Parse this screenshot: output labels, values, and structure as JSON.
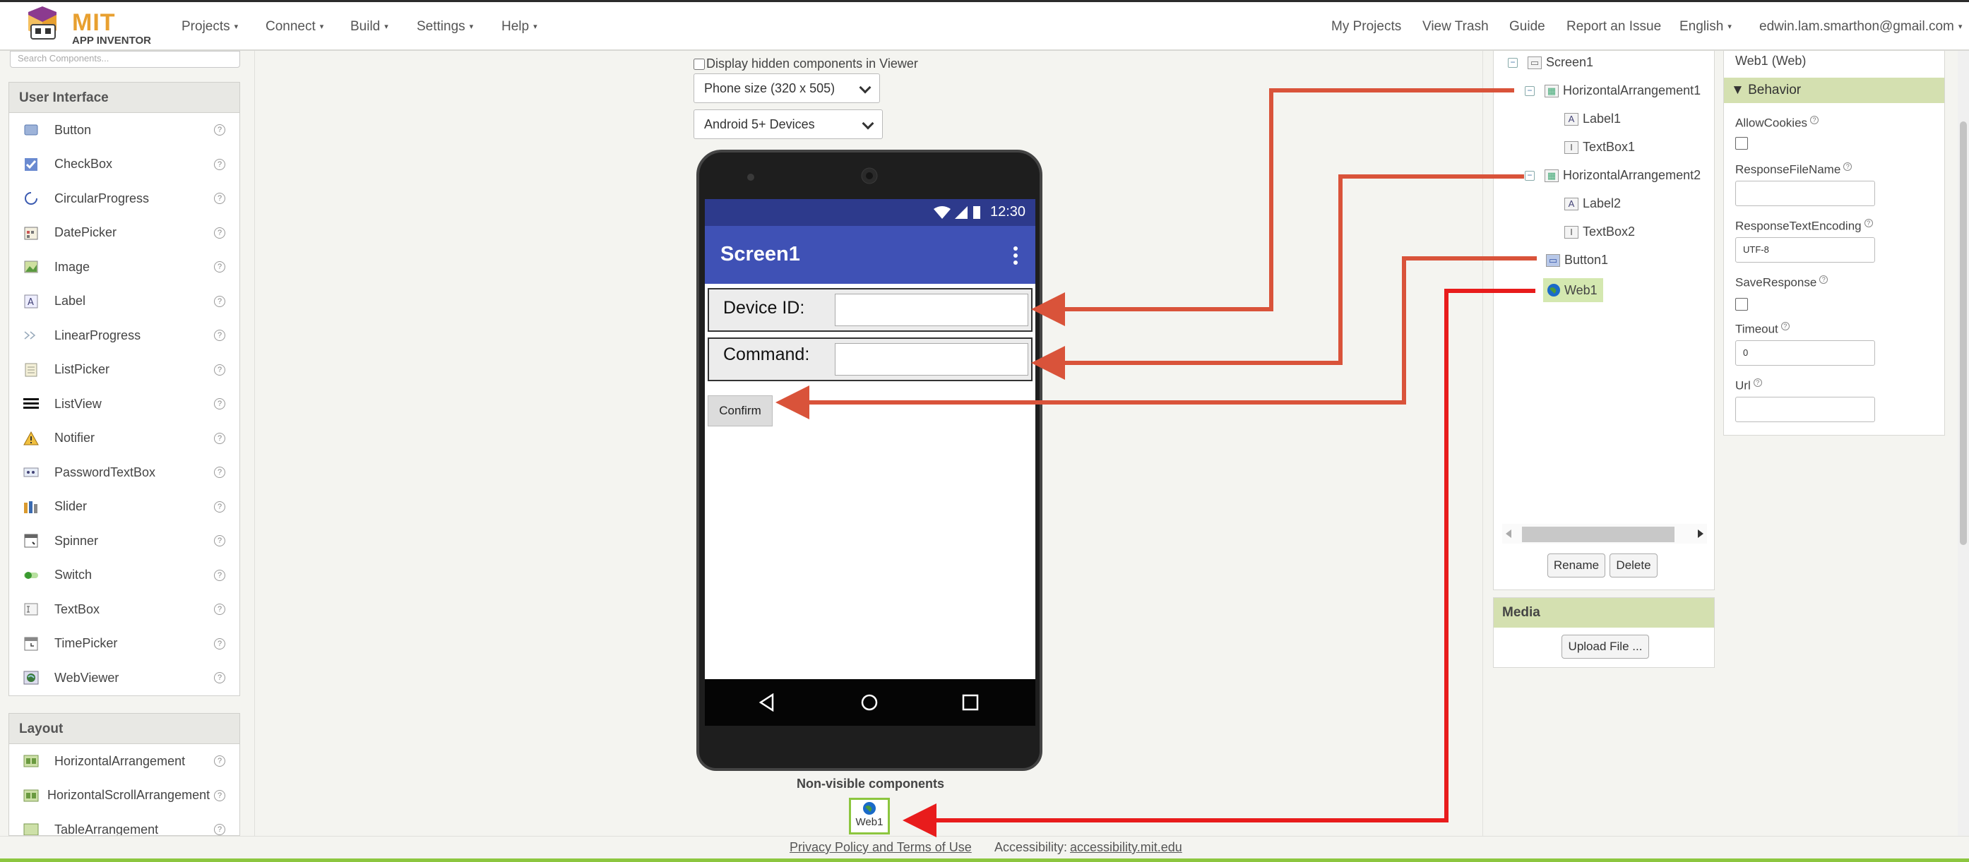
{
  "app": {
    "logo_main": "MIT",
    "logo_sub": "APP INVENTOR"
  },
  "topnav": {
    "left": [
      "Projects",
      "Connect",
      "Build",
      "Settings",
      "Help"
    ],
    "right": {
      "my_projects": "My Projects",
      "view_trash": "View Trash",
      "guide": "Guide",
      "report": "Report an Issue",
      "language": "English",
      "account": "edwin.lam.smarthon@gmail.com"
    }
  },
  "palette": {
    "search_placeholder": "Search Components...",
    "user_interface_header": "User Interface",
    "user_interface_items": [
      {
        "label": "Button",
        "icon": "button-icon"
      },
      {
        "label": "CheckBox",
        "icon": "checkbox-icon"
      },
      {
        "label": "CircularProgress",
        "icon": "circular-progress-icon"
      },
      {
        "label": "DatePicker",
        "icon": "datepicker-icon"
      },
      {
        "label": "Image",
        "icon": "image-icon"
      },
      {
        "label": "Label",
        "icon": "label-icon"
      },
      {
        "label": "LinearProgress",
        "icon": "linear-progress-icon"
      },
      {
        "label": "ListPicker",
        "icon": "listpicker-icon"
      },
      {
        "label": "ListView",
        "icon": "listview-icon"
      },
      {
        "label": "Notifier",
        "icon": "notifier-icon"
      },
      {
        "label": "PasswordTextBox",
        "icon": "password-icon"
      },
      {
        "label": "Slider",
        "icon": "slider-icon"
      },
      {
        "label": "Spinner",
        "icon": "spinner-icon"
      },
      {
        "label": "Switch",
        "icon": "switch-icon"
      },
      {
        "label": "TextBox",
        "icon": "textbox-icon"
      },
      {
        "label": "TimePicker",
        "icon": "timepicker-icon"
      },
      {
        "label": "WebViewer",
        "icon": "webviewer-icon"
      }
    ],
    "layout_header": "Layout",
    "layout_items": [
      {
        "label": "HorizontalArrangement",
        "icon": "horizontal-arrangement-icon"
      },
      {
        "label": "HorizontalScrollArrangement",
        "icon": "horizontal-scroll-arrangement-icon"
      },
      {
        "label": "TableArrangement",
        "icon": "table-arrangement-icon"
      }
    ],
    "help_glyph": "?"
  },
  "viewer": {
    "hidden_components_label": "Display hidden components in Viewer",
    "phone_size": "Phone size (320 x 505)",
    "devices": "Android 5+ Devices",
    "status_time": "12:30",
    "screen_title": "Screen1",
    "label1": "Device ID:",
    "label2": "Command:",
    "button": "Confirm",
    "nonvisible_label": "Non-visible components",
    "nonvisible_web": "Web1"
  },
  "components_tree": {
    "screen": "Screen1",
    "harr1": "HorizontalArrangement1",
    "label1": "Label1",
    "textbox1": "TextBox1",
    "harr2": "HorizontalArrangement2",
    "label2": "Label2",
    "textbox2": "TextBox2",
    "button1": "Button1",
    "web1": "Web1",
    "rename": "Rename",
    "delete": "Delete"
  },
  "media": {
    "header": "Media",
    "upload": "Upload File ..."
  },
  "properties": {
    "title": "Web1 (Web)",
    "section": "Behavior",
    "allow_cookies": "AllowCookies",
    "response_file_name": "ResponseFileName",
    "response_text_encoding": "ResponseTextEncoding",
    "response_text_encoding_value": "UTF-8",
    "save_response": "SaveResponse",
    "timeout": "Timeout",
    "timeout_value": "0",
    "url": "Url"
  },
  "footer": {
    "privacy": "Privacy Policy and Terms of Use",
    "accessibility_label": "Accessibility:",
    "accessibility_link": "accessibility.mit.edu"
  },
  "colors": {
    "arrow": "#d9533a",
    "arrow_web": "#e81c1c",
    "accent_green": "#8cc63f",
    "app_bar": "#3f51b5"
  }
}
